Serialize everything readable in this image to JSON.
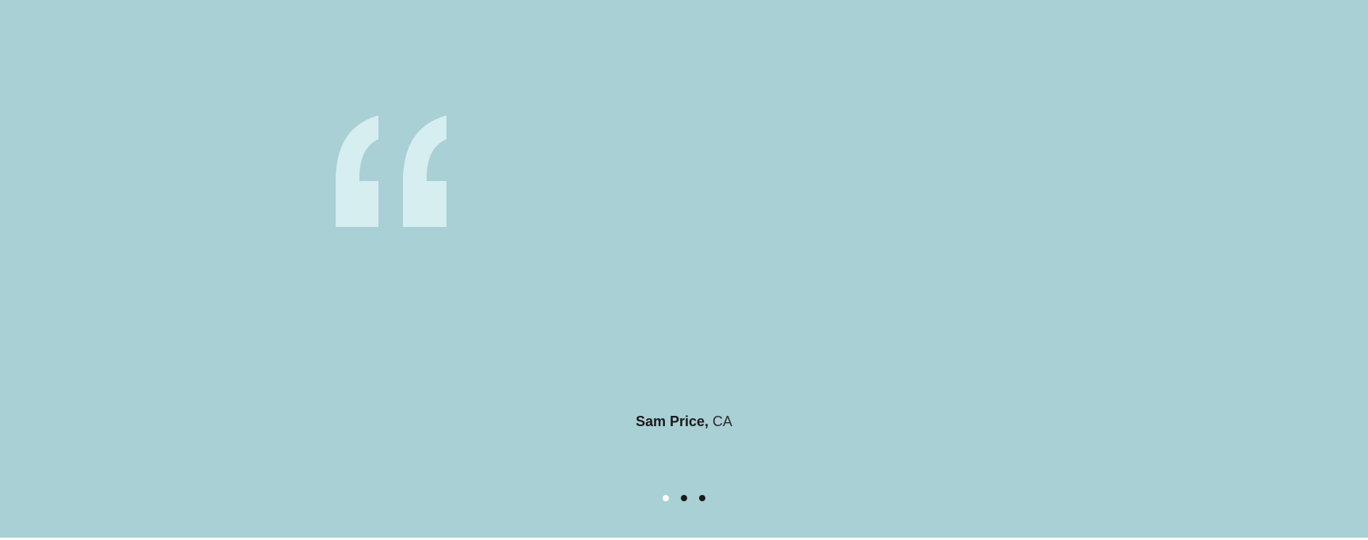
{
  "testimonial": {
    "quote_icon": "open-quote-icon",
    "quote_icon_color": "#d6eef0",
    "background_color": "#a8d0d5",
    "author": {
      "name": "Sam Price,",
      "location": "CA"
    }
  },
  "pagination": {
    "total": 3,
    "active_index": 0,
    "active_color": "#ffffff",
    "inactive_color": "#1a1a1a"
  }
}
